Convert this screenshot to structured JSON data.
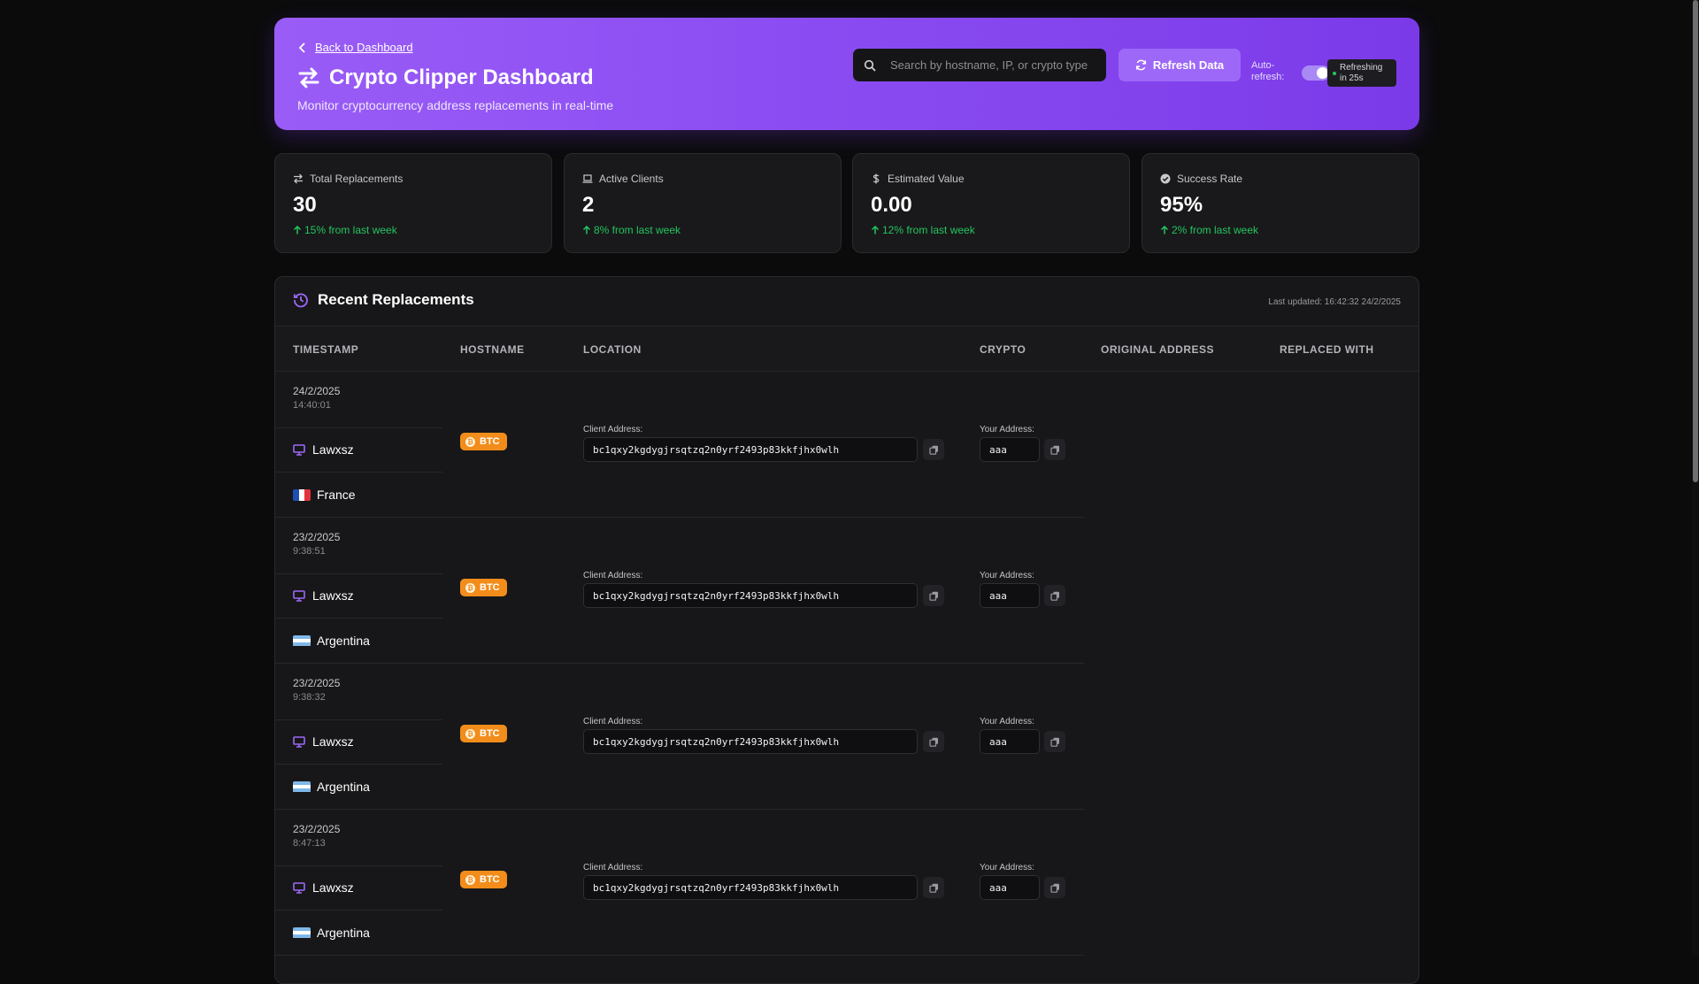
{
  "header": {
    "back_label": "Back to Dashboard",
    "title": "Crypto Clipper Dashboard",
    "subtitle": "Monitor cryptocurrency address replacements in real-time",
    "search_placeholder": "Search by hostname, IP, or crypto type",
    "refresh_label": "Refresh Data",
    "auto_refresh_label": "Auto-refresh:",
    "refresh_status": "Refreshing in 25s"
  },
  "stats": [
    {
      "label": "Total Replacements",
      "value": "30",
      "change": "15% from last week",
      "icon": "swap-icon"
    },
    {
      "label": "Active Clients",
      "value": "2",
      "change": "8% from last week",
      "icon": "laptop-icon"
    },
    {
      "label": "Estimated Value",
      "value": "0.00",
      "change": "12% from last week",
      "icon": "dollar-icon"
    },
    {
      "label": "Success Rate",
      "value": "95%",
      "change": "2% from last week",
      "icon": "check-circle-icon"
    }
  ],
  "table": {
    "title": "Recent Replacements",
    "last_updated": "Last updated: 16:42:32 24/2/2025",
    "columns": [
      "TIMESTAMP",
      "HOSTNAME",
      "LOCATION",
      "CRYPTO",
      "ORIGINAL ADDRESS",
      "REPLACED WITH"
    ],
    "client_address_label": "Client Address:",
    "your_address_label": "Your Address:",
    "rows": [
      {
        "date": "24/2/2025",
        "time": "14:40:01",
        "hostname": "Lawxsz",
        "country": "France",
        "crypto": "BTC",
        "client_address": "bc1qxy2kgdygjrsqtzq2n0yrf2493p83kkfjhx0wlh",
        "your_address": "aaa"
      },
      {
        "date": "23/2/2025",
        "time": "9:38:51",
        "hostname": "Lawxsz",
        "country": "Argentina",
        "crypto": "BTC",
        "client_address": "bc1qxy2kgdygjrsqtzq2n0yrf2493p83kkfjhx0wlh",
        "your_address": "aaa"
      },
      {
        "date": "23/2/2025",
        "time": "9:38:32",
        "hostname": "Lawxsz",
        "country": "Argentina",
        "crypto": "BTC",
        "client_address": "bc1qxy2kgdygjrsqtzq2n0yrf2493p83kkfjhx0wlh",
        "your_address": "aaa"
      },
      {
        "date": "23/2/2025",
        "time": "8:47:13",
        "hostname": "Lawxsz",
        "country": "Argentina",
        "crypto": "BTC",
        "client_address": "bc1qxy2kgdygjrsqtzq2n0yrf2493p83kkfjhx0wlh",
        "your_address": "aaa"
      }
    ]
  },
  "colors": {
    "accent": "#8b4df2",
    "positive": "#22c55e",
    "btc": "#f28d1b"
  }
}
